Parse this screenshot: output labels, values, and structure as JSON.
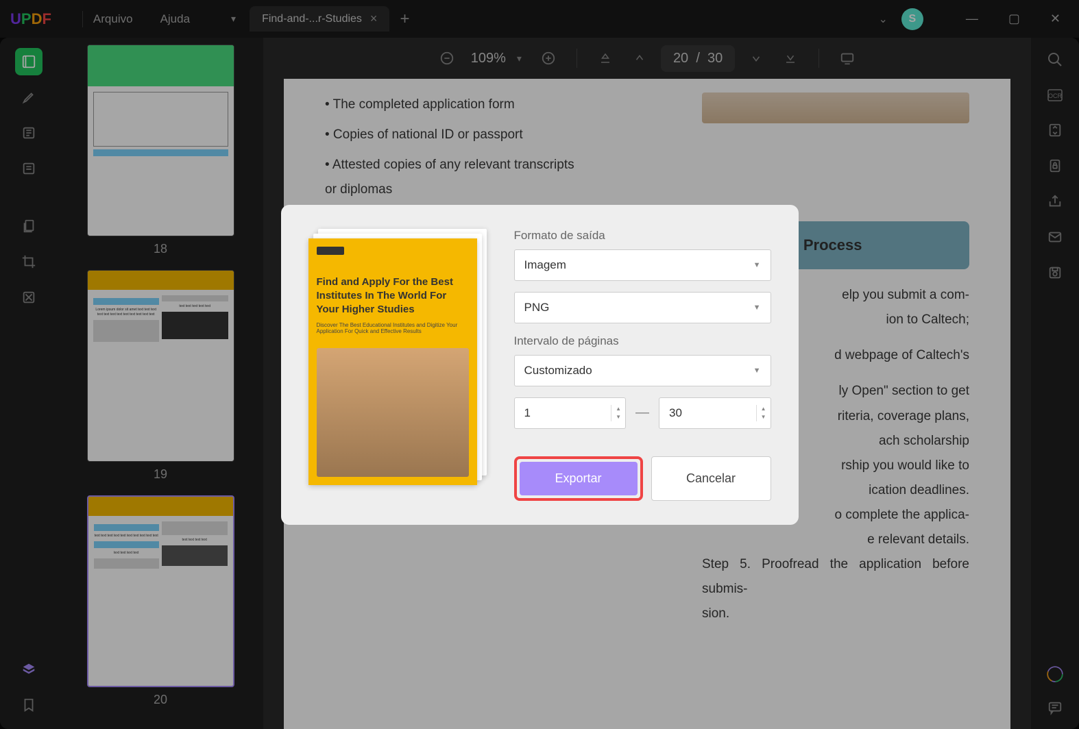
{
  "titlebar": {
    "menu_file": "Arquivo",
    "menu_help": "Ajuda",
    "tab_title": "Find-and-...r-Studies",
    "avatar_initial": "S"
  },
  "toolbar": {
    "zoom_value": "109%",
    "page_current": "20",
    "page_sep": "/",
    "page_total": "30"
  },
  "thumbnails": [
    {
      "label": "18"
    },
    {
      "label": "19"
    },
    {
      "label": "20"
    }
  ],
  "document": {
    "bullets": [
      "• The completed application form",
      "• Copies of national ID or passport",
      "• Attested copies of any relevant transcripts or diplomas"
    ],
    "section_header": "Application Process",
    "para1": "elp you submit a com-",
    "para2": "ion to Caltech;",
    "para3": "d webpage of Caltech's",
    "para4": "ly Open\" section to get",
    "para5": "riteria, coverage plans,",
    "para6": "ach scholarship",
    "para7": "rship you would like to",
    "para8": "ication deadlines.",
    "para9": "o complete the applica-",
    "para10": "e relevant details.",
    "step5": "Step 5. Proofread the application before submis-",
    "step5b": "sion."
  },
  "preview": {
    "title": "Find and Apply For the Best Institutes In The World For Your Higher Studies",
    "subtitle": "Discover The Best Educational Institutes and Digitize Your Application For Quick and Effective Results"
  },
  "dialog": {
    "output_format_label": "Formato de saída",
    "format_value": "Imagem",
    "file_type_value": "PNG",
    "page_range_label": "Intervalo de páginas",
    "range_mode": "Customizado",
    "range_from": "1",
    "range_to": "30",
    "export_btn": "Exportar",
    "cancel_btn": "Cancelar"
  }
}
